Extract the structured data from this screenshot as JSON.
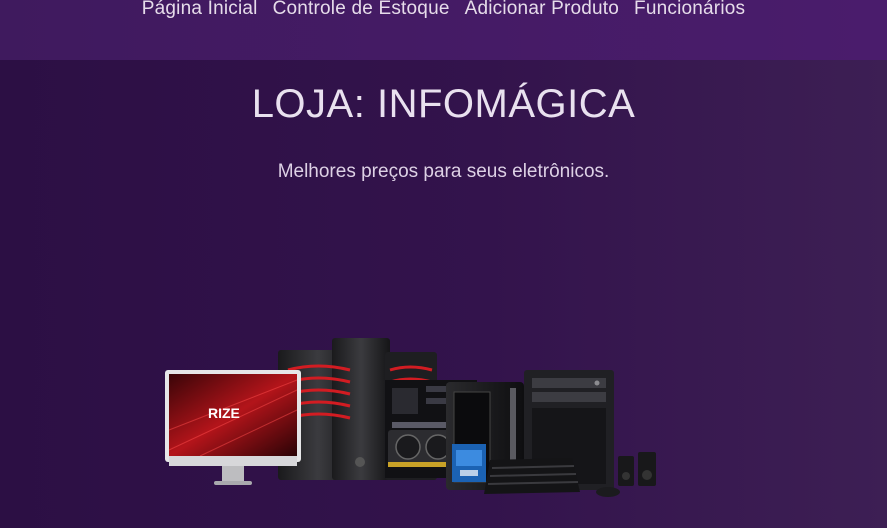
{
  "nav": {
    "items": [
      {
        "label": "Página Inicial"
      },
      {
        "label": "Controle de Estoque"
      },
      {
        "label": "Adicionar Produto"
      },
      {
        "label": "Funcionários"
      }
    ]
  },
  "hero": {
    "title": "LOJA: INFOMÁGICA",
    "subtitle": "Melhores preços para seus eletrônicos."
  },
  "banner": {
    "brand_text": "RIZE"
  },
  "colors": {
    "navbar": "#4a1c6c",
    "background": "#2c0f44",
    "accent_red": "#c4171d"
  }
}
